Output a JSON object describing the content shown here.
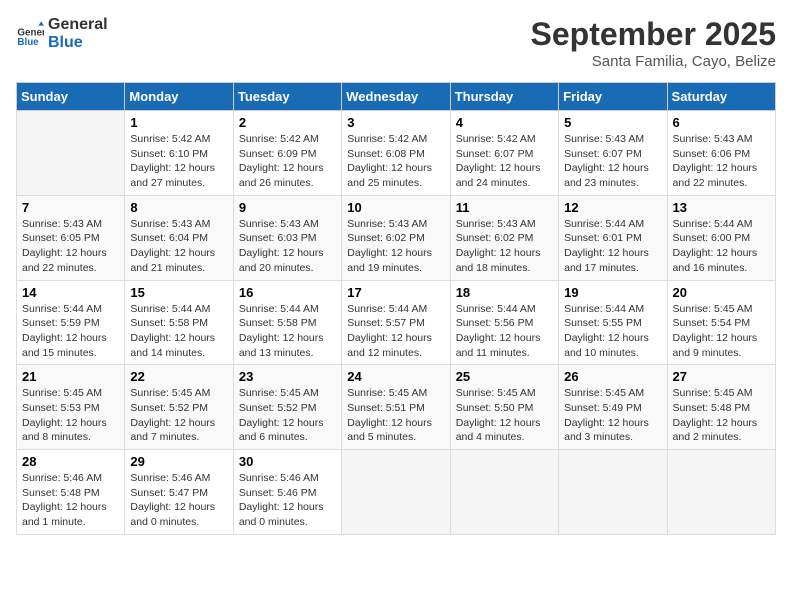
{
  "logo": {
    "line1": "General",
    "line2": "Blue"
  },
  "title": "September 2025",
  "subtitle": "Santa Familia, Cayo, Belize",
  "days_of_week": [
    "Sunday",
    "Monday",
    "Tuesday",
    "Wednesday",
    "Thursday",
    "Friday",
    "Saturday"
  ],
  "weeks": [
    [
      {
        "num": "",
        "detail": ""
      },
      {
        "num": "1",
        "detail": "Sunrise: 5:42 AM\nSunset: 6:10 PM\nDaylight: 12 hours\nand 27 minutes."
      },
      {
        "num": "2",
        "detail": "Sunrise: 5:42 AM\nSunset: 6:09 PM\nDaylight: 12 hours\nand 26 minutes."
      },
      {
        "num": "3",
        "detail": "Sunrise: 5:42 AM\nSunset: 6:08 PM\nDaylight: 12 hours\nand 25 minutes."
      },
      {
        "num": "4",
        "detail": "Sunrise: 5:42 AM\nSunset: 6:07 PM\nDaylight: 12 hours\nand 24 minutes."
      },
      {
        "num": "5",
        "detail": "Sunrise: 5:43 AM\nSunset: 6:07 PM\nDaylight: 12 hours\nand 23 minutes."
      },
      {
        "num": "6",
        "detail": "Sunrise: 5:43 AM\nSunset: 6:06 PM\nDaylight: 12 hours\nand 22 minutes."
      }
    ],
    [
      {
        "num": "7",
        "detail": "Sunrise: 5:43 AM\nSunset: 6:05 PM\nDaylight: 12 hours\nand 22 minutes."
      },
      {
        "num": "8",
        "detail": "Sunrise: 5:43 AM\nSunset: 6:04 PM\nDaylight: 12 hours\nand 21 minutes."
      },
      {
        "num": "9",
        "detail": "Sunrise: 5:43 AM\nSunset: 6:03 PM\nDaylight: 12 hours\nand 20 minutes."
      },
      {
        "num": "10",
        "detail": "Sunrise: 5:43 AM\nSunset: 6:02 PM\nDaylight: 12 hours\nand 19 minutes."
      },
      {
        "num": "11",
        "detail": "Sunrise: 5:43 AM\nSunset: 6:02 PM\nDaylight: 12 hours\nand 18 minutes."
      },
      {
        "num": "12",
        "detail": "Sunrise: 5:44 AM\nSunset: 6:01 PM\nDaylight: 12 hours\nand 17 minutes."
      },
      {
        "num": "13",
        "detail": "Sunrise: 5:44 AM\nSunset: 6:00 PM\nDaylight: 12 hours\nand 16 minutes."
      }
    ],
    [
      {
        "num": "14",
        "detail": "Sunrise: 5:44 AM\nSunset: 5:59 PM\nDaylight: 12 hours\nand 15 minutes."
      },
      {
        "num": "15",
        "detail": "Sunrise: 5:44 AM\nSunset: 5:58 PM\nDaylight: 12 hours\nand 14 minutes."
      },
      {
        "num": "16",
        "detail": "Sunrise: 5:44 AM\nSunset: 5:58 PM\nDaylight: 12 hours\nand 13 minutes."
      },
      {
        "num": "17",
        "detail": "Sunrise: 5:44 AM\nSunset: 5:57 PM\nDaylight: 12 hours\nand 12 minutes."
      },
      {
        "num": "18",
        "detail": "Sunrise: 5:44 AM\nSunset: 5:56 PM\nDaylight: 12 hours\nand 11 minutes."
      },
      {
        "num": "19",
        "detail": "Sunrise: 5:44 AM\nSunset: 5:55 PM\nDaylight: 12 hours\nand 10 minutes."
      },
      {
        "num": "20",
        "detail": "Sunrise: 5:45 AM\nSunset: 5:54 PM\nDaylight: 12 hours\nand 9 minutes."
      }
    ],
    [
      {
        "num": "21",
        "detail": "Sunrise: 5:45 AM\nSunset: 5:53 PM\nDaylight: 12 hours\nand 8 minutes."
      },
      {
        "num": "22",
        "detail": "Sunrise: 5:45 AM\nSunset: 5:52 PM\nDaylight: 12 hours\nand 7 minutes."
      },
      {
        "num": "23",
        "detail": "Sunrise: 5:45 AM\nSunset: 5:52 PM\nDaylight: 12 hours\nand 6 minutes."
      },
      {
        "num": "24",
        "detail": "Sunrise: 5:45 AM\nSunset: 5:51 PM\nDaylight: 12 hours\nand 5 minutes."
      },
      {
        "num": "25",
        "detail": "Sunrise: 5:45 AM\nSunset: 5:50 PM\nDaylight: 12 hours\nand 4 minutes."
      },
      {
        "num": "26",
        "detail": "Sunrise: 5:45 AM\nSunset: 5:49 PM\nDaylight: 12 hours\nand 3 minutes."
      },
      {
        "num": "27",
        "detail": "Sunrise: 5:45 AM\nSunset: 5:48 PM\nDaylight: 12 hours\nand 2 minutes."
      }
    ],
    [
      {
        "num": "28",
        "detail": "Sunrise: 5:46 AM\nSunset: 5:48 PM\nDaylight: 12 hours\nand 1 minute."
      },
      {
        "num": "29",
        "detail": "Sunrise: 5:46 AM\nSunset: 5:47 PM\nDaylight: 12 hours\nand 0 minutes."
      },
      {
        "num": "30",
        "detail": "Sunrise: 5:46 AM\nSunset: 5:46 PM\nDaylight: 12 hours\nand 0 minutes."
      },
      {
        "num": "",
        "detail": ""
      },
      {
        "num": "",
        "detail": ""
      },
      {
        "num": "",
        "detail": ""
      },
      {
        "num": "",
        "detail": ""
      }
    ]
  ]
}
